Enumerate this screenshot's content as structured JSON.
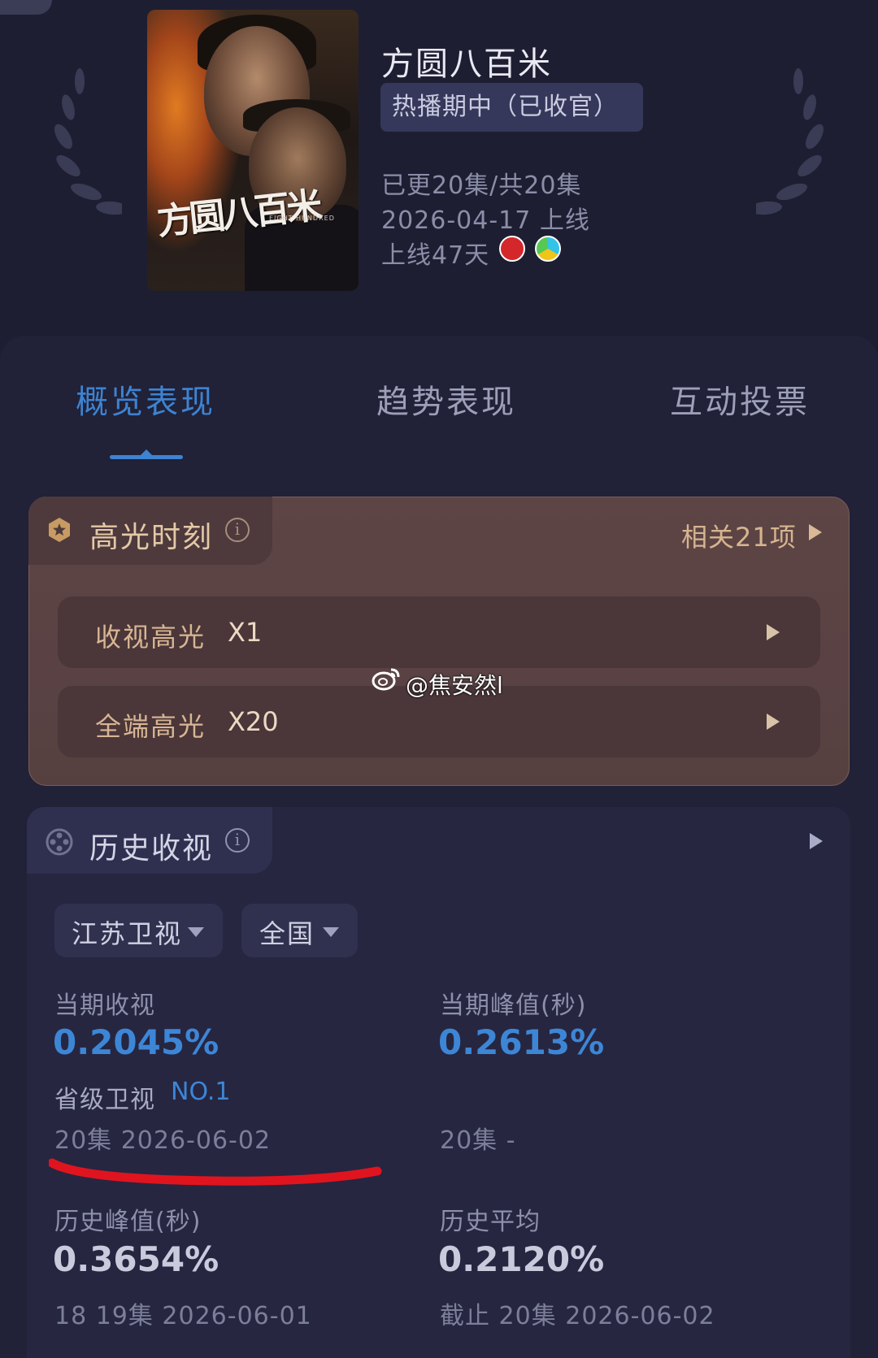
{
  "show": {
    "title": "方圆八百米",
    "status": "热播期中（已收官）",
    "episodes": "已更20集/共20集",
    "release": "2026-04-17 上线",
    "days_online": "上线47天",
    "platform_icons": [
      "tv-station-red-icon",
      "video-platform-icon"
    ],
    "poster": {
      "calligraphy_title": "方圆八百米",
      "english_title": "EIGHT HUNDRED"
    }
  },
  "tabs": [
    {
      "label": "概览表现",
      "active": true
    },
    {
      "label": "趋势表现",
      "active": false
    },
    {
      "label": "互动投票",
      "active": false
    }
  ],
  "highlights": {
    "title": "高光时刻",
    "related": "相关21项",
    "rows": [
      {
        "label": "收视高光",
        "value": "X1"
      },
      {
        "label": "全端高光",
        "value": "X20"
      }
    ]
  },
  "watermark": "@焦安然l",
  "history": {
    "title": "历史收视",
    "filters": {
      "channel": "江苏卫视",
      "region": "全国"
    },
    "current": {
      "label": "当期收视",
      "value": "0.2045%",
      "rank_label": "省级卫视",
      "rank": "NO.1",
      "sub": "20集  2026-06-02"
    },
    "current_peak": {
      "label": "当期峰值(秒)",
      "value": "0.2613%",
      "sub": "20集  -"
    },
    "historical_peak": {
      "label": "历史峰值(秒)",
      "value": "0.3654%",
      "sub": "18 19集  2026-06-01"
    },
    "historical_avg": {
      "label": "历史平均",
      "value": "0.2120%",
      "sub": "截止 20集  2026-06-02"
    }
  },
  "colors": {
    "background": "#1e1e32",
    "accent_blue": "#3d83d2",
    "highlight_gold": "#d6b48e",
    "annotation_red": "#e0141e"
  }
}
